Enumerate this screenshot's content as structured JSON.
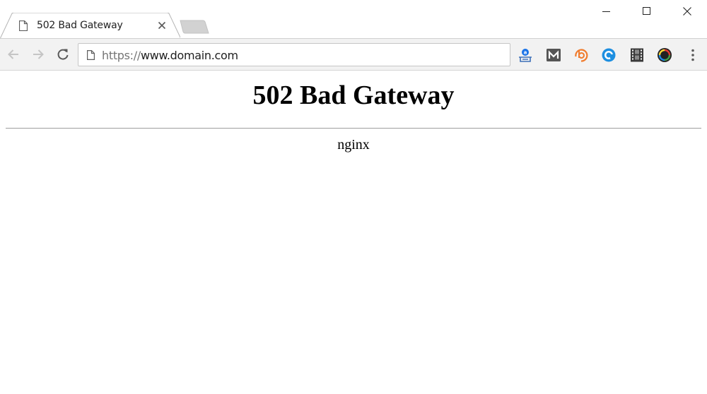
{
  "tab": {
    "title": "502 Bad Gateway",
    "icon": "page-icon"
  },
  "window_controls": {
    "minimize_icon": "minimize-icon",
    "maximize_icon": "maximize-icon",
    "close_icon": "close-icon"
  },
  "toolbar": {
    "back_icon": "back-arrow-icon",
    "forward_icon": "forward-arrow-icon",
    "reload_icon": "reload-icon",
    "address": {
      "scheme": "https://",
      "host": "www.domain.com",
      "icon": "page-info-icon"
    },
    "extensions": [
      {
        "name": "translate-extension-icon",
        "color": "#1a73e8"
      },
      {
        "name": "m-extension-icon",
        "color": "#555555"
      },
      {
        "name": "b-extension-icon",
        "color": "#f07c2e"
      },
      {
        "name": "at-extension-icon",
        "color": "#1e8fe0"
      },
      {
        "name": "film-extension-icon",
        "color": "#3a3a3a"
      },
      {
        "name": "color-wheel-extension-icon",
        "color": "#222222"
      }
    ],
    "menu_icon": "more-vert-icon"
  },
  "page": {
    "heading": "502 Bad Gateway",
    "server": "nginx"
  }
}
